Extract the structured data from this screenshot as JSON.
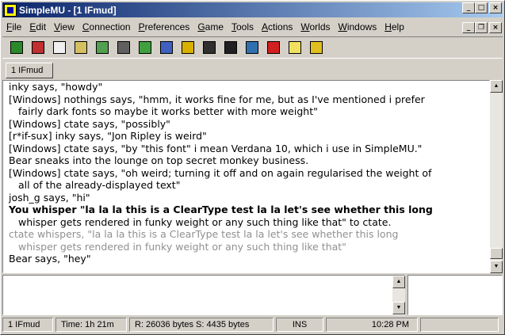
{
  "window": {
    "title": "SimpleMU - [1 IFmud]"
  },
  "caption_buttons": {
    "minimize": "_",
    "maximize": "□",
    "close": "×"
  },
  "mdi_buttons": {
    "minimize": "_",
    "restore": "❐",
    "close": "×"
  },
  "menu": [
    {
      "label": "File",
      "u": "F",
      "rest": "ile"
    },
    {
      "label": "Edit",
      "u": "E",
      "rest": "dit"
    },
    {
      "label": "View",
      "u": "V",
      "rest": "iew"
    },
    {
      "label": "Connection",
      "u": "C",
      "rest": "onnection"
    },
    {
      "label": "Preferences",
      "u": "P",
      "rest": "references"
    },
    {
      "label": "Game",
      "u": "G",
      "rest": "ame"
    },
    {
      "label": "Tools",
      "u": "T",
      "rest": "ools"
    },
    {
      "label": "Actions",
      "u": "A",
      "rest": "ctions"
    },
    {
      "label": "Worlds",
      "u": "W",
      "rest": "orlds"
    },
    {
      "label": "Windows",
      "u": "W",
      "rest": "indows"
    },
    {
      "label": "Help",
      "u": "H",
      "rest": "elp"
    }
  ],
  "toolbar": [
    {
      "icon": "connect-icon",
      "color": "#2a8a2a"
    },
    {
      "icon": "disconnect-icon",
      "color": "#c03030"
    },
    {
      "icon": "new-document-icon",
      "color": "#f0f0f0"
    },
    {
      "icon": "sound-icon",
      "color": "#d4c060"
    },
    {
      "icon": "world-icon",
      "color": "#50a050"
    },
    {
      "icon": "settings-icon",
      "color": "#606060"
    },
    {
      "icon": "download-icon",
      "color": "#40a040"
    },
    {
      "icon": "edit-icon",
      "color": "#4060c0"
    },
    {
      "icon": "pause-icon",
      "color": "#d8b000"
    },
    {
      "icon": "script-icon",
      "color": "#303030"
    },
    {
      "icon": "binoculars-icon",
      "color": "#202020"
    },
    {
      "icon": "globe-icon",
      "color": "#3070b0"
    },
    {
      "icon": "spellcheck-icon",
      "color": "#d02020"
    },
    {
      "icon": "help-icon",
      "color": "#f0e060"
    },
    {
      "icon": "log-icon",
      "color": "#e0c020"
    }
  ],
  "tabs": [
    {
      "label": "1 IFmud"
    }
  ],
  "output_lines": [
    {
      "text": "inky says, \"howdy\"",
      "style": ""
    },
    {
      "text": "[Windows] nothings says, \"hmm, it works fine for me, but as I've mentioned i prefer",
      "style": ""
    },
    {
      "text": "fairly dark fonts so maybe it works better with more weight\"",
      "style": "wrap"
    },
    {
      "text": "[Windows] ctate says, \"possibly\"",
      "style": ""
    },
    {
      "text": "[r*if-sux] inky says, \"Jon Ripley is weird\"",
      "style": ""
    },
    {
      "text": "[Windows] ctate says, \"by \"this font\" i mean Verdana 10, which i use in SimpleMU.\"",
      "style": ""
    },
    {
      "text": "Bear sneaks into the lounge on top secret monkey business.",
      "style": ""
    },
    {
      "text": "[Windows] ctate says, \"oh weird; turning it off and on again regularised the weight of",
      "style": ""
    },
    {
      "text": "all of the already-displayed text\"",
      "style": "wrap"
    },
    {
      "text": "josh_g says, \"hi\"",
      "style": ""
    },
    {
      "text": "You whisper \"la la la this is a ClearType test la la let's see whether this long",
      "style": "bold"
    },
    {
      "text": "whisper gets rendered in funky weight or any such thing like that\" to ctate.",
      "style": "wrap"
    },
    {
      "text": "ctate whispers, \"la la la this is a ClearType test la la let's see whether this long",
      "style": "gray"
    },
    {
      "text": "whisper gets rendered in funky weight or any such thing like that\"",
      "style": "gray wrap"
    },
    {
      "text": "Bear says, \"hey\"",
      "style": ""
    }
  ],
  "status": {
    "world": "1 IFmud",
    "time": "Time: 1h 21m",
    "bytes": "R: 26036 bytes S: 4435 bytes",
    "mode": "INS",
    "clock": "10:28 PM"
  }
}
